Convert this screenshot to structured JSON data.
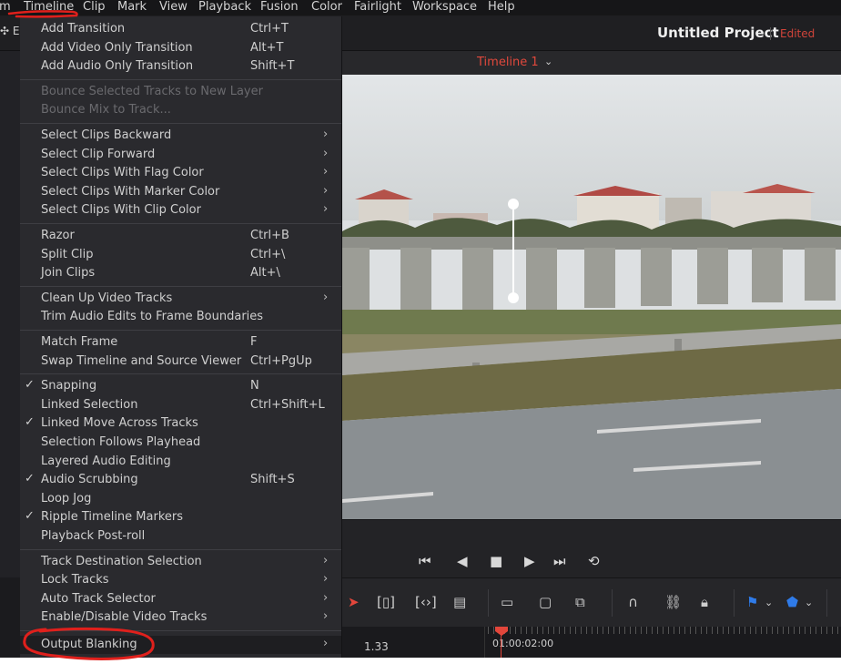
{
  "menubar": {
    "items": [
      "m",
      "Timeline",
      "Clip",
      "Mark",
      "View",
      "Playback",
      "Fusion",
      "Color",
      "Fairlight",
      "Workspace",
      "Help"
    ]
  },
  "header": {
    "edit_fragment": "E",
    "project_title": "Untitled Project",
    "project_status": "Edited"
  },
  "viewer": {
    "timeline_name": "Timeline 1"
  },
  "timeline_menu": {
    "groups": [
      [
        {
          "label": "Add Transition",
          "shortcut": "Ctrl+T"
        },
        {
          "label": "Add Video Only Transition",
          "shortcut": "Alt+T"
        },
        {
          "label": "Add Audio Only Transition",
          "shortcut": "Shift+T"
        }
      ],
      [
        {
          "label": "Bounce Selected Tracks to New Layer",
          "disabled": true
        },
        {
          "label": "Bounce Mix to Track...",
          "disabled": true
        }
      ],
      [
        {
          "label": "Select Clips Backward",
          "submenu": true
        },
        {
          "label": "Select Clip Forward",
          "submenu": true
        },
        {
          "label": "Select Clips With Flag Color",
          "submenu": true
        },
        {
          "label": "Select Clips With Marker Color",
          "submenu": true
        },
        {
          "label": "Select Clips With Clip Color",
          "submenu": true
        }
      ],
      [
        {
          "label": "Razor",
          "shortcut": "Ctrl+B"
        },
        {
          "label": "Split Clip",
          "shortcut": "Ctrl+\\"
        },
        {
          "label": "Join Clips",
          "shortcut": "Alt+\\"
        }
      ],
      [
        {
          "label": "Clean Up Video Tracks",
          "submenu": true
        },
        {
          "label": "Trim Audio Edits to Frame Boundaries"
        }
      ],
      [
        {
          "label": "Match Frame",
          "shortcut": "F"
        },
        {
          "label": "Swap Timeline and Source Viewer",
          "shortcut": "Ctrl+PgUp"
        }
      ],
      [
        {
          "label": "Snapping",
          "shortcut": "N",
          "checked": true
        },
        {
          "label": "Linked Selection",
          "shortcut": "Ctrl+Shift+L"
        },
        {
          "label": "Linked Move Across Tracks",
          "checked": true
        },
        {
          "label": "Selection Follows Playhead"
        },
        {
          "label": "Layered Audio Editing"
        },
        {
          "label": "Audio Scrubbing",
          "shortcut": "Shift+S",
          "checked": true
        },
        {
          "label": "Loop Jog"
        },
        {
          "label": "Ripple Timeline Markers",
          "checked": true
        },
        {
          "label": "Playback Post-roll"
        }
      ],
      [
        {
          "label": "Track Destination Selection",
          "submenu": true
        },
        {
          "label": "Lock Tracks",
          "submenu": true
        },
        {
          "label": "Auto Track Selector",
          "submenu": true
        },
        {
          "label": "Enable/Disable Video Tracks",
          "submenu": true
        }
      ],
      [
        {
          "label": "Output Blanking",
          "submenu": true,
          "highlighted": true
        }
      ]
    ]
  },
  "timeline": {
    "zoom": "1.33",
    "timecode": "01:00:02:00"
  },
  "icons": {
    "check": "check-icon",
    "submenu": "chevron-right-icon",
    "playhead": "playhead-icon"
  },
  "colors": {
    "accent_red": "#e3463b",
    "flag_blue": "#2f7be8",
    "annotation_red": "#e0201c"
  }
}
